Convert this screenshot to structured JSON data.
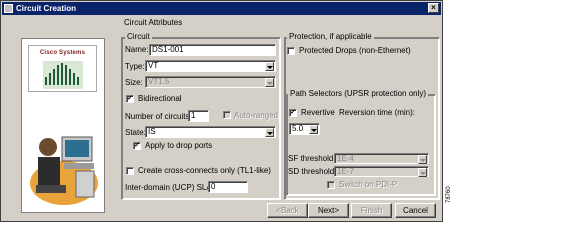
{
  "window": {
    "title": "Circuit Creation",
    "close_glyph": "×"
  },
  "brand": {
    "logo_text": "Cisco Systems"
  },
  "attributes": {
    "title": "Circuit Attributes"
  },
  "circuit": {
    "group_title": "Circuit",
    "name_label": "Name:",
    "name_value": "DS1-001",
    "type_label": "Type:",
    "type_value": "VT",
    "size_label": "Size:",
    "size_value": "VT1.5",
    "bidirectional_label": "Bidirectional",
    "bidirectional_checked": true,
    "num_circuits_label": "Number of circuits:",
    "num_circuits_value": "1",
    "auto_ranged_label": "Auto-ranged",
    "state_label": "State:",
    "state_value": "IS",
    "apply_drop_label": "Apply to drop ports",
    "apply_drop_checked": true,
    "cross_connects_label": "Create cross-connects only (TL1-like)",
    "cross_connects_checked": false,
    "inter_domain_label": "Inter-domain (UCP) SLA:",
    "inter_domain_value": "0"
  },
  "protection": {
    "group_title": "Protection, if applicable",
    "protected_drops_label": "Protected Drops (non-Ethernet)",
    "protected_drops_checked": false,
    "path_selectors_title": "Path Selectors (UPSR protection only)",
    "revertive_label": "Revertive",
    "revertive_checked": true,
    "reversion_label": "Reversion time (min):",
    "reversion_value": "5.0",
    "sf_label": "SF threshold:",
    "sf_value": "1E-4",
    "sd_label": "SD threshold:",
    "sd_value": "1E-7",
    "switch_pdi_label": "Switch on PDI-P"
  },
  "buttons": {
    "back": "<Back",
    "next": "Next>",
    "finish": "Finish",
    "cancel": "Cancel"
  },
  "figure_number": "78760",
  "check_glyph": "✓"
}
